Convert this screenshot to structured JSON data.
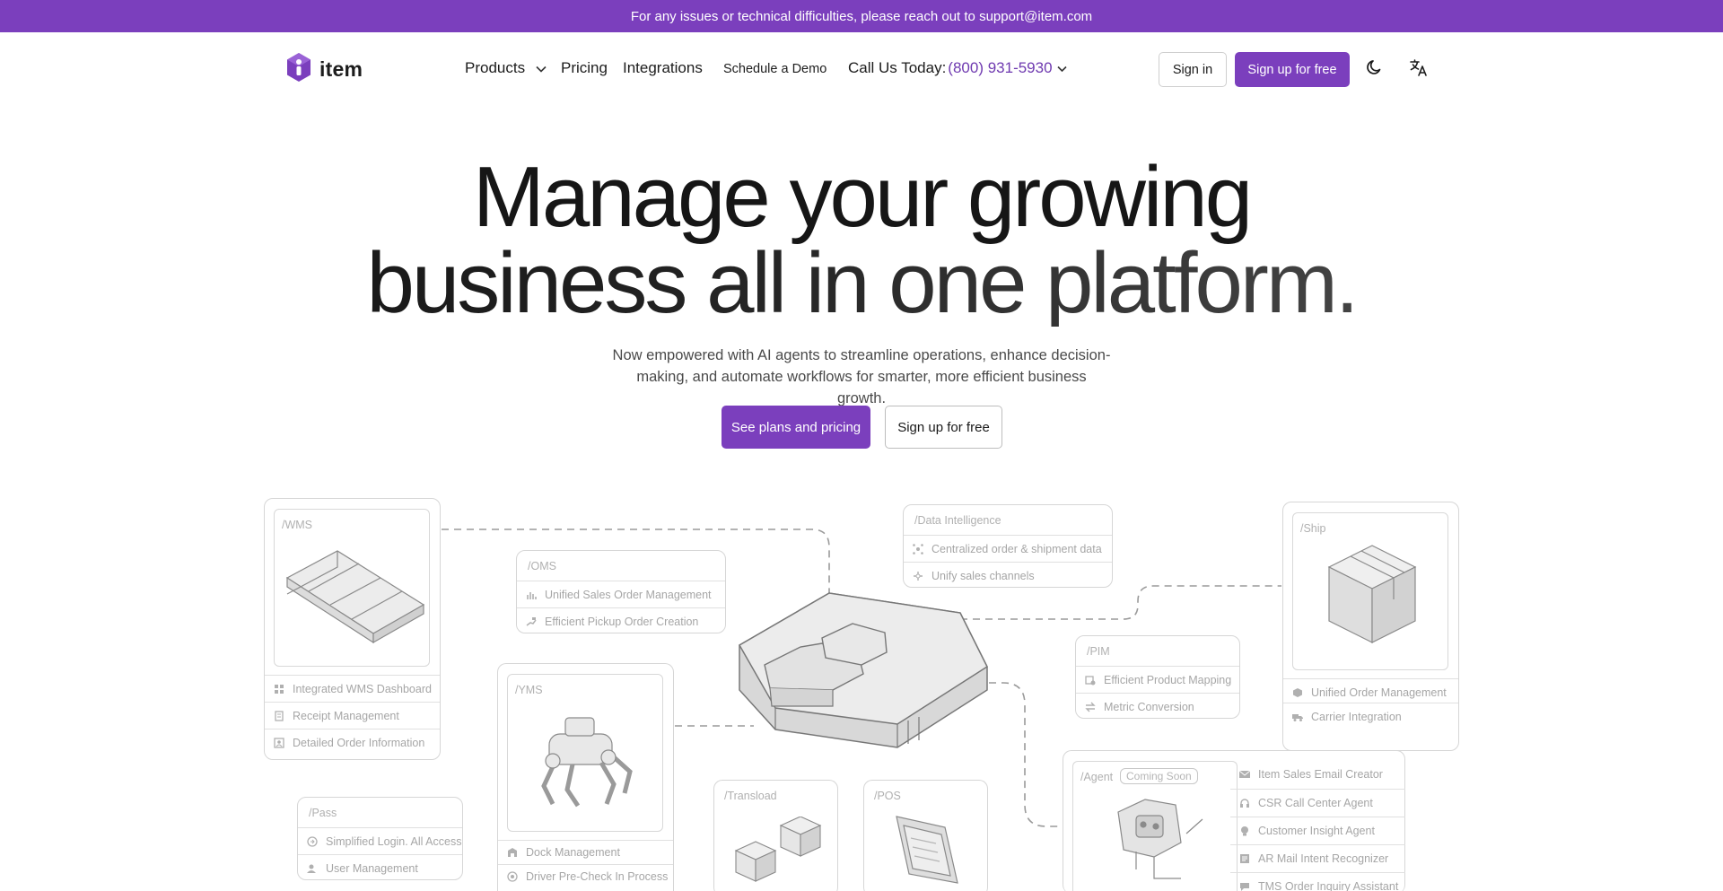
{
  "banner": {
    "text": "For any issues or technical difficulties, please reach out to support@item.com"
  },
  "header": {
    "logo_text": "item",
    "nav": {
      "products": "Products",
      "pricing": "Pricing",
      "integrations": "Integrations",
      "demo": "Schedule a Demo",
      "call_label": "Call Us Today:",
      "call_phone": "(800) 931-5930"
    },
    "signin": "Sign in",
    "signup": "Sign up for free"
  },
  "hero": {
    "title_line1": "Manage your growing",
    "title_line2": "business all in one platform.",
    "subtitle": "Now empowered with AI agents to streamline operations, enhance decision-making, and automate workflows for smarter, more efficient business growth.",
    "cta_primary": "See plans and pricing",
    "cta_secondary": "Sign up for free"
  },
  "diagram": {
    "wms": {
      "tag": "/WMS",
      "rows": [
        "Integrated WMS Dashboard",
        "Receipt Management",
        "Detailed Order Information"
      ]
    },
    "oms": {
      "tag": "/OMS",
      "rows": [
        "Unified Sales Order Management",
        "Efficient Pickup Order Creation"
      ]
    },
    "data": {
      "tag": "/Data Intelligence",
      "rows": [
        "Centralized order & shipment data",
        "Unify sales channels"
      ]
    },
    "ship": {
      "tag": "/Ship",
      "rows": [
        "Unified Order Management",
        "Carrier Integration"
      ]
    },
    "pim": {
      "tag": "/PIM",
      "rows": [
        "Efficient Product Mapping",
        "Metric Conversion"
      ]
    },
    "yms": {
      "tag": "/YMS",
      "rows": [
        "Dock Management",
        "Driver Pre-Check In Process"
      ]
    },
    "pass": {
      "tag": "/Pass",
      "rows": [
        "Simplified Login. All Access.",
        "User Management"
      ]
    },
    "transload": {
      "tag": "/Transload"
    },
    "pos": {
      "tag": "/POS"
    },
    "agent": {
      "tag": "/Agent",
      "badge": "Coming Soon",
      "rows": [
        "Item Sales Email Creator",
        "CSR Call Center Agent",
        "Customer Insight Agent",
        "AR Mail Intent Recognizer",
        "TMS Order Inquiry Assistant"
      ]
    }
  },
  "colors": {
    "brand": "#7b3fbd",
    "phone": "#6f3ab0"
  }
}
